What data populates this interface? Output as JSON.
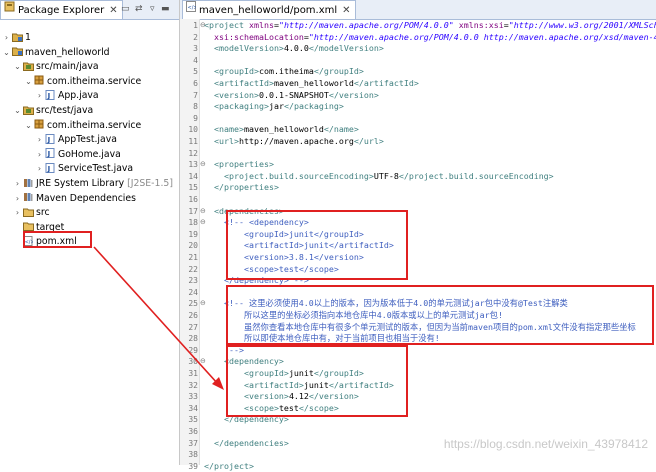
{
  "explorer": {
    "tab_label": "Package Explorer",
    "close_glyph": "✕",
    "tree": [
      {
        "indent": 0,
        "toggle": "›",
        "icon": "project-icon",
        "label": "1"
      },
      {
        "indent": 0,
        "toggle": "⌄",
        "icon": "project-icon",
        "label": "maven_helloworld"
      },
      {
        "indent": 1,
        "toggle": "⌄",
        "icon": "source-folder-icon",
        "label": "src/main/java"
      },
      {
        "indent": 2,
        "toggle": "⌄",
        "icon": "package-icon",
        "label": "com.itheima.service"
      },
      {
        "indent": 3,
        "toggle": "›",
        "icon": "java-file-icon",
        "label": "App.java"
      },
      {
        "indent": 1,
        "toggle": "⌄",
        "icon": "source-folder-icon",
        "label": "src/test/java"
      },
      {
        "indent": 2,
        "toggle": "⌄",
        "icon": "package-icon",
        "label": "com.itheima.service"
      },
      {
        "indent": 3,
        "toggle": "›",
        "icon": "java-file-icon",
        "label": "AppTest.java"
      },
      {
        "indent": 3,
        "toggle": "›",
        "icon": "java-file-icon",
        "label": "GoHome.java"
      },
      {
        "indent": 3,
        "toggle": "›",
        "icon": "java-file-icon",
        "label": "ServiceTest.java"
      },
      {
        "indent": 1,
        "toggle": "›",
        "icon": "library-icon",
        "label": "JRE System Library",
        "suffix": "[J2SE-1.5]"
      },
      {
        "indent": 1,
        "toggle": "›",
        "icon": "library-icon",
        "label": "Maven Dependencies"
      },
      {
        "indent": 1,
        "toggle": "›",
        "icon": "folder-icon",
        "label": "src"
      },
      {
        "indent": 1,
        "toggle": "",
        "icon": "folder-icon",
        "label": "target"
      },
      {
        "indent": 1,
        "toggle": "",
        "icon": "xml-file-icon",
        "label": "pom.xml"
      }
    ]
  },
  "editor": {
    "tab_label": "maven_helloworld/pom.xml",
    "close_glyph": "✕",
    "lines": [
      {
        "n": "1",
        "fold": "⊖",
        "code": [
          [
            "t",
            "<project "
          ],
          [
            "a",
            "xmlns"
          ],
          [
            "tx",
            "="
          ],
          [
            "v",
            "\"http://maven.apache.org/POM/4.0.0\""
          ],
          [
            "tx",
            " "
          ],
          [
            "a",
            "xmlns:xsi"
          ],
          [
            "tx",
            "="
          ],
          [
            "v",
            "\"http://www.w3.org/2001/XMLSch"
          ]
        ]
      },
      {
        "n": "2",
        "code": [
          [
            "tx",
            "  "
          ],
          [
            "a",
            "xsi:schemaLocation"
          ],
          [
            "tx",
            "="
          ],
          [
            "v",
            "\"http://maven.apache.org/POM/4.0.0 http://maven.apache.org/xsd/maven-4"
          ]
        ]
      },
      {
        "n": "3",
        "code": [
          [
            "tx",
            "  "
          ],
          [
            "t",
            "<modelVersion>"
          ],
          [
            "tx",
            "4.0.0"
          ],
          [
            "t",
            "</modelVersion>"
          ]
        ]
      },
      {
        "n": "4",
        "code": []
      },
      {
        "n": "5",
        "code": [
          [
            "tx",
            "  "
          ],
          [
            "t",
            "<groupId>"
          ],
          [
            "tx",
            "com.itheima"
          ],
          [
            "t",
            "</groupId>"
          ]
        ]
      },
      {
        "n": "6",
        "code": [
          [
            "tx",
            "  "
          ],
          [
            "t",
            "<artifactId>"
          ],
          [
            "tx",
            "maven_helloworld"
          ],
          [
            "t",
            "</artifactId>"
          ]
        ]
      },
      {
        "n": "7",
        "code": [
          [
            "tx",
            "  "
          ],
          [
            "t",
            "<version>"
          ],
          [
            "tx",
            "0.0.1-SNAPSHOT"
          ],
          [
            "t",
            "</version>"
          ]
        ]
      },
      {
        "n": "8",
        "code": [
          [
            "tx",
            "  "
          ],
          [
            "t",
            "<packaging>"
          ],
          [
            "tx",
            "jar"
          ],
          [
            "t",
            "</packaging>"
          ]
        ]
      },
      {
        "n": "9",
        "code": []
      },
      {
        "n": "10",
        "code": [
          [
            "tx",
            "  "
          ],
          [
            "t",
            "<name>"
          ],
          [
            "tx",
            "maven_helloworld"
          ],
          [
            "t",
            "</name>"
          ]
        ]
      },
      {
        "n": "11",
        "code": [
          [
            "tx",
            "  "
          ],
          [
            "t",
            "<url>"
          ],
          [
            "tx",
            "http://maven.apache.org"
          ],
          [
            "t",
            "</url>"
          ]
        ]
      },
      {
        "n": "12",
        "code": []
      },
      {
        "n": "13",
        "fold": "⊖",
        "code": [
          [
            "tx",
            "  "
          ],
          [
            "t",
            "<properties>"
          ]
        ]
      },
      {
        "n": "14",
        "code": [
          [
            "tx",
            "    "
          ],
          [
            "t",
            "<project.build.sourceEncoding>"
          ],
          [
            "tx",
            "UTF-8"
          ],
          [
            "t",
            "</project.build.sourceEncoding>"
          ]
        ]
      },
      {
        "n": "15",
        "code": [
          [
            "tx",
            "  "
          ],
          [
            "t",
            "</properties>"
          ]
        ]
      },
      {
        "n": "16",
        "code": []
      },
      {
        "n": "17",
        "fold": "⊖",
        "code": [
          [
            "tx",
            "  "
          ],
          [
            "t",
            "<dependencies>"
          ]
        ]
      },
      {
        "n": "18",
        "fold": "⊖",
        "code": [
          [
            "tx",
            "    "
          ],
          [
            "cm",
            "<!-- <dependency>"
          ]
        ]
      },
      {
        "n": "19",
        "code": [
          [
            "cm",
            "        <groupId>junit</groupId>"
          ]
        ]
      },
      {
        "n": "20",
        "code": [
          [
            "cm",
            "        <artifactId>junit</artifactId>"
          ]
        ]
      },
      {
        "n": "21",
        "code": [
          [
            "cm",
            "        <version>3.8.1</version>"
          ]
        ]
      },
      {
        "n": "22",
        "code": [
          [
            "cm",
            "        <scope>test</scope>"
          ]
        ]
      },
      {
        "n": "23",
        "code": [
          [
            "cm",
            "    </dependency> -->"
          ]
        ]
      },
      {
        "n": "24",
        "code": []
      },
      {
        "n": "25",
        "fold": "⊖",
        "code": [
          [
            "tx",
            "    "
          ],
          [
            "cm",
            "<!-- 这里必须使用4.0以上的版本，因为版本低于4.0的单元测试jar包中没有@Test注解类"
          ]
        ]
      },
      {
        "n": "26",
        "code": [
          [
            "cm",
            "        所以这里的坐标必须指向本地仓库中4.0版本或以上的单元测试jar包!"
          ]
        ]
      },
      {
        "n": "27",
        "code": [
          [
            "cm",
            "        虽然你查看本地仓库中有很多个单元测试的版本，但因为当前maven项目的pom.xml文件没有指定那些坐标"
          ]
        ]
      },
      {
        "n": "28",
        "code": [
          [
            "cm",
            "        所以即使本地仓库中有，对于当前项目也相当于没有!"
          ]
        ]
      },
      {
        "n": "29",
        "code": [
          [
            "cm",
            "     -->"
          ]
        ]
      },
      {
        "n": "30",
        "fold": "⊖",
        "code": [
          [
            "tx",
            "    "
          ],
          [
            "t",
            "<dependency>"
          ]
        ]
      },
      {
        "n": "31",
        "code": [
          [
            "tx",
            "        "
          ],
          [
            "t",
            "<groupId>"
          ],
          [
            "tx",
            "junit"
          ],
          [
            "t",
            "</groupId>"
          ]
        ]
      },
      {
        "n": "32",
        "code": [
          [
            "tx",
            "        "
          ],
          [
            "t",
            "<artifactId>"
          ],
          [
            "tx",
            "junit"
          ],
          [
            "t",
            "</artifactId>"
          ]
        ]
      },
      {
        "n": "33",
        "code": [
          [
            "tx",
            "        "
          ],
          [
            "t",
            "<version>"
          ],
          [
            "tx",
            "4.12"
          ],
          [
            "t",
            "</version>"
          ]
        ]
      },
      {
        "n": "34",
        "code": [
          [
            "tx",
            "        "
          ],
          [
            "t",
            "<scope>"
          ],
          [
            "tx",
            "test"
          ],
          [
            "t",
            "</scope>"
          ]
        ]
      },
      {
        "n": "35",
        "code": [
          [
            "tx",
            "    "
          ],
          [
            "t",
            "</dependency>"
          ]
        ]
      },
      {
        "n": "36",
        "code": []
      },
      {
        "n": "37",
        "code": [
          [
            "tx",
            "  "
          ],
          [
            "t",
            "</dependencies>"
          ]
        ]
      },
      {
        "n": "38",
        "code": []
      },
      {
        "n": "39",
        "code": [
          [
            "t",
            "</project>"
          ]
        ]
      }
    ]
  },
  "watermark": "https://blog.csdn.net/weixin_43978412",
  "colors": {
    "annotation_red": "#e02020",
    "tag": "#3f7f7f",
    "attr": "#7f007f",
    "value": "#2a00ff",
    "comment": "#3f5fbf"
  }
}
